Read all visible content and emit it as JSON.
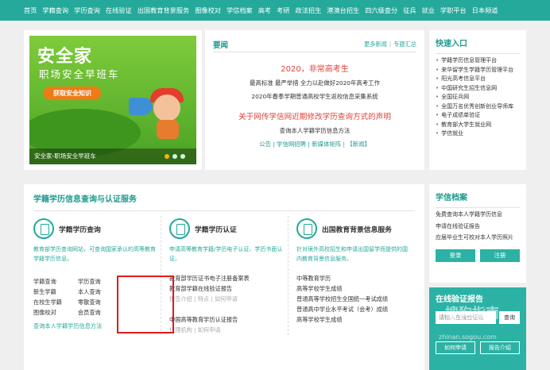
{
  "nav": [
    "首页",
    "学籍查询",
    "学历查询",
    "在线验证",
    "出国教育背景服务",
    "图像校对",
    "学信档案",
    "高考",
    "考研",
    "政法招生",
    "港澳台招生",
    "四六级查分",
    "征兵",
    "就业",
    "学职平台",
    "日本频道"
  ],
  "banner": {
    "brand": "安全家",
    "slogan": "职场安全早班车",
    "button": "获取安全知识",
    "caption": "安全家-职场安全早班车"
  },
  "news": {
    "title": "要闻",
    "more": "更多新闻",
    "topics": "专题汇总",
    "headline1": "2020，非常高考生",
    "sub1": "最高标准 最严举措 全力以赴做好2020年高考工作",
    "sub2": "2020年春季学期普通高校学生返校信息采集系统",
    "headline2": "关于网传学信网近期修改学历查询方式的声明",
    "sub3": "查询本人学籍学历信息方法",
    "links": "公告 | 学信网招聘 | 新媒体矩阵 | 【新闻】"
  },
  "quick": {
    "title": "快速入口",
    "items": [
      "学籍学历信息管理平台",
      "来华留学生学籍学历管理平台",
      "阳光高考信息平台",
      "中国研究生招生信息网",
      "全国征兵网",
      "全国万名优秀创新创业导师库",
      "电子成绩单验证",
      "教育部大学生就业网",
      "学信就业"
    ]
  },
  "main": {
    "title": "学籍学历信息查询与认证服务",
    "col1": {
      "name": "学籍学历查询",
      "desc": "教育部学历查询网站，可查询国家承认的高等教育学籍学历信息。",
      "left": [
        "学籍查询",
        "新生学籍",
        "在校生学籍",
        "图像校对"
      ],
      "right": [
        "学历查询",
        "本人查询",
        "零散查询",
        "会员查询"
      ],
      "foot": "查询本人学籍学历信息方法"
    },
    "col2": {
      "name": "学籍学历认证",
      "desc": "申请高等教育学籍/学历电子认证、学历书面认证。",
      "items": [
        "教育部学历证书电子注册备案表",
        "教育部学籍在线验证报告",
        "报告介绍 | 特点 | 如何申请",
        "",
        "中国高等教育学历认证报告",
        "代理机构 | 如何申请"
      ]
    },
    "col3": {
      "name": "出国教育背景信息服务",
      "desc": "针对境外高校招生和申请出国留学而提供的国内教育背景信息服务。",
      "items": [
        "中等教育学历",
        "高等学校学生成绩",
        "普通高等学校招生全国统一考试成绩",
        "普通高中学业水平考试（会考）成绩",
        "高等学校学生成绩"
      ]
    }
  },
  "archive": {
    "title": "学信档案",
    "lines": [
      "免费查询本人学籍学历信息",
      "申请在线验证报告",
      "应届毕业生可校对本人学历照片"
    ],
    "login": "登录",
    "register": "注册"
  },
  "verify": {
    "title": "在线验证报告",
    "placeholder": "请输入在线验证码",
    "search": "查询",
    "how": "如何申请",
    "intro": "报告介绍"
  },
  "watermark": {
    "logo": "搜狗指南",
    "url": "zhinan.sogou.com"
  }
}
